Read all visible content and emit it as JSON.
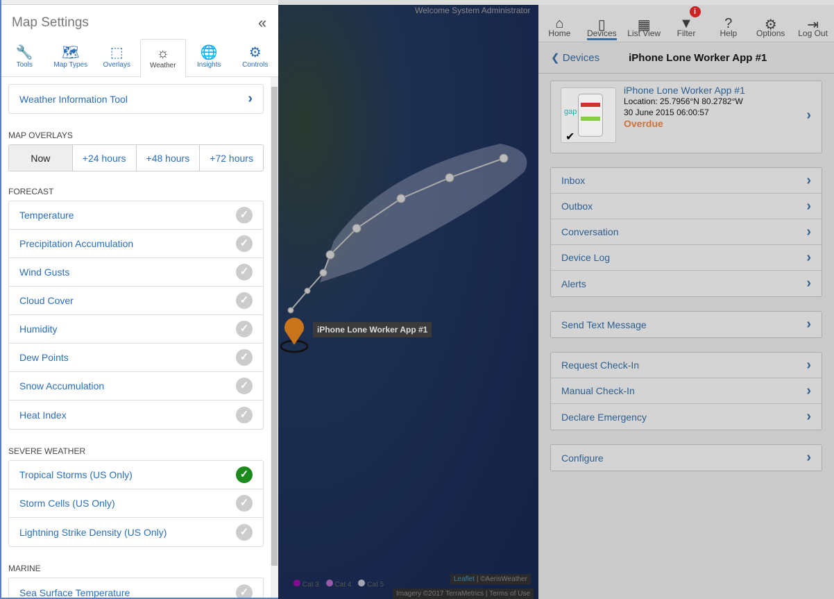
{
  "left": {
    "title": "Map Settings",
    "tabs": [
      {
        "label": "Tools",
        "icon": "wrench-icon"
      },
      {
        "label": "Map Types",
        "icon": "map-icon"
      },
      {
        "label": "Overlays",
        "icon": "overlays-icon"
      },
      {
        "label": "Weather",
        "icon": "sun-icon",
        "active": true
      },
      {
        "label": "Insights",
        "icon": "globe-icon"
      },
      {
        "label": "Controls",
        "icon": "gears-icon"
      }
    ],
    "weather_tool": "Weather Information Tool",
    "overlays_heading": "MAP OVERLAYS",
    "overlay_times": [
      "Now",
      "+24 hours",
      "+48 hours",
      "+72 hours"
    ],
    "overlay_selected": "Now",
    "forecast_heading": "FORECAST",
    "forecast": [
      {
        "label": "Temperature",
        "on": false
      },
      {
        "label": "Precipitation Accumulation",
        "on": false
      },
      {
        "label": "Wind Gusts",
        "on": false
      },
      {
        "label": "Cloud Cover",
        "on": false
      },
      {
        "label": "Humidity",
        "on": false
      },
      {
        "label": "Dew Points",
        "on": false
      },
      {
        "label": "Snow Accumulation",
        "on": false
      },
      {
        "label": "Heat Index",
        "on": false
      }
    ],
    "severe_heading": "SEVERE WEATHER",
    "severe": [
      {
        "label": "Tropical Storms (US Only)",
        "on": true
      },
      {
        "label": "Storm Cells (US Only)",
        "on": false
      },
      {
        "label": "Lightning Strike Density (US Only)",
        "on": false
      }
    ],
    "marine_heading": "MARINE",
    "marine": [
      {
        "label": "Sea Surface Temperature",
        "on": false
      }
    ]
  },
  "map": {
    "welcome": "Welcome System Administrator",
    "marker_label": "iPhone Lone Worker App #1",
    "legend": [
      "Cat 3",
      "Cat 4",
      "Cat 5"
    ],
    "legend_colors": [
      "#b000b0",
      "#d070d0",
      "#dddddd"
    ],
    "leaflet": "Leaflet",
    "aeris": "| ©AerisWeather",
    "imagery": "Imagery ©2017 TerraMetrics",
    "terms": "Terms of Use"
  },
  "right": {
    "nav": [
      {
        "label": "Home",
        "icon": "home-icon"
      },
      {
        "label": "Devices",
        "icon": "phone-icon",
        "active": true
      },
      {
        "label": "List View",
        "icon": "grid-icon"
      },
      {
        "label": "Filter",
        "icon": "filter-icon",
        "badge": "i"
      },
      {
        "label": "Help",
        "icon": "help-icon"
      },
      {
        "label": "Options",
        "icon": "gear-icon"
      },
      {
        "label": "Log Out",
        "icon": "logout-icon"
      }
    ],
    "back": "Devices",
    "title": "iPhone Lone Worker App #1",
    "device": {
      "name": "iPhone Lone Worker App #1",
      "location": "Location: 25.7956°N 80.2782°W",
      "time": "30 June 2015 06:00:57",
      "status": "Overdue",
      "status_color": "#c8743a"
    },
    "groups": [
      [
        "Inbox",
        "Outbox",
        "Conversation",
        "Device Log",
        "Alerts"
      ],
      [
        "Send Text Message"
      ],
      [
        "Request Check-In",
        "Manual Check-In",
        "Declare Emergency"
      ],
      [
        "Configure"
      ]
    ]
  }
}
